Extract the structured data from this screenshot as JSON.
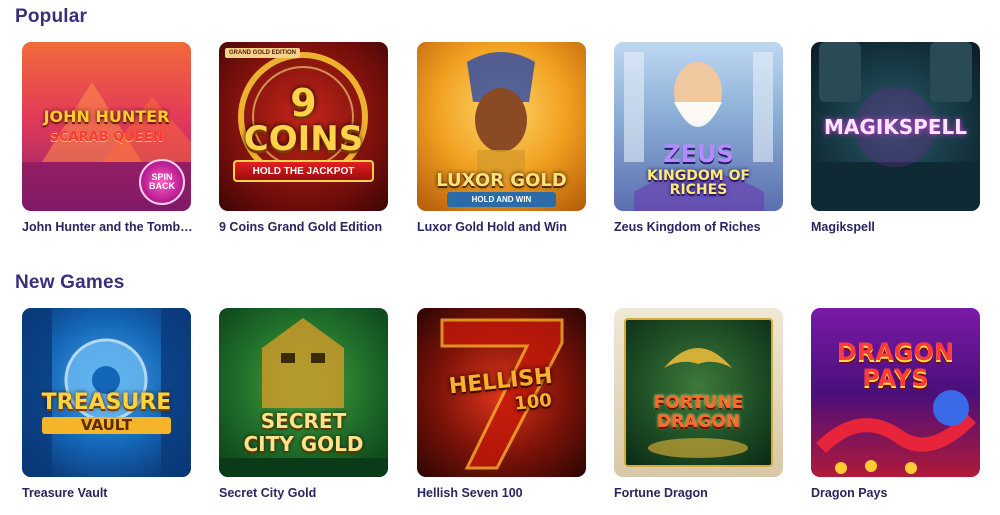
{
  "sections": [
    {
      "title": "Popular",
      "games": [
        {
          "title": "John Hunter and the Tomb of the Scarab Queen",
          "art_lines": [
            "John Hunter",
            "Scarab Queen"
          ],
          "badge": "SPIN BACK"
        },
        {
          "title": "9 Coins Grand Gold Edition",
          "art_lines": [
            "9",
            "Coins"
          ],
          "ribbon": "HOLD THE JACKPOT",
          "tag": "GRAND GOLD EDITION"
        },
        {
          "title": "Luxor Gold Hold and Win",
          "art_lines": [
            "Luxor Gold"
          ],
          "sub": "HOLD AND WIN"
        },
        {
          "title": "Zeus Kingdom of Riches",
          "art_lines": [
            "Zeus",
            "Kingdom of Riches"
          ]
        },
        {
          "title": "Magikspell",
          "art_lines": [
            "Magikspell"
          ]
        }
      ]
    },
    {
      "title": "New Games",
      "games": [
        {
          "title": "Treasure Vault",
          "art_lines": [
            "Treasure",
            "Vault"
          ]
        },
        {
          "title": "Secret City Gold",
          "art_lines": [
            "Secret",
            "City Gold"
          ]
        },
        {
          "title": "Hellish Seven 100",
          "art_lines": [
            "Hellish",
            "100"
          ]
        },
        {
          "title": "Fortune Dragon",
          "art_lines": [
            "Fortune",
            "Dragon"
          ]
        },
        {
          "title": "Dragon Pays",
          "art_lines": [
            "Dragon",
            "Pays"
          ]
        }
      ]
    }
  ]
}
